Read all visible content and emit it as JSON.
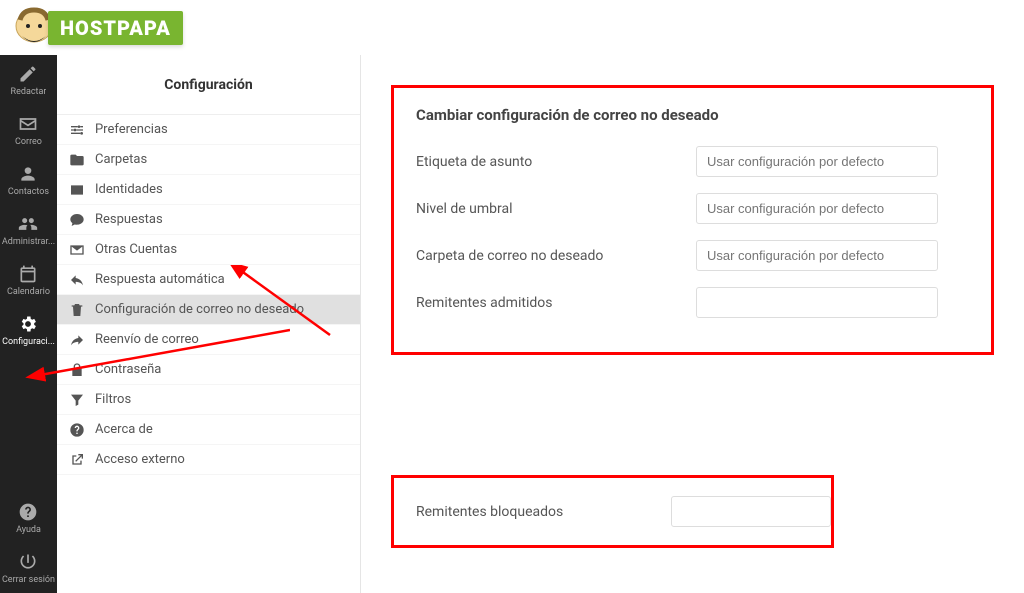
{
  "brand": "HOSTPAPA",
  "sidebar": {
    "items": [
      {
        "icon": "edit",
        "label": "Redactar"
      },
      {
        "icon": "mail",
        "label": "Correo"
      },
      {
        "icon": "contacts",
        "label": "Contactos"
      },
      {
        "icon": "users",
        "label": "Administrar..."
      },
      {
        "icon": "calendar",
        "label": "Calendario"
      },
      {
        "icon": "gear",
        "label": "Configuraci..."
      }
    ],
    "bottom": [
      {
        "icon": "help",
        "label": "Ayuda"
      },
      {
        "icon": "power",
        "label": "Cerrar sesión"
      }
    ]
  },
  "settings": {
    "header": "Configuración",
    "items": [
      {
        "icon": "sliders",
        "label": "Preferencias"
      },
      {
        "icon": "folder",
        "label": "Carpetas"
      },
      {
        "icon": "idcard",
        "label": "Identidades"
      },
      {
        "icon": "comment",
        "label": "Respuestas"
      },
      {
        "icon": "envelope",
        "label": "Otras Cuentas"
      },
      {
        "icon": "reply",
        "label": "Respuesta automática"
      },
      {
        "icon": "trash",
        "label": "Configuración de correo no deseado"
      },
      {
        "icon": "forward",
        "label": "Reenvío de correo"
      },
      {
        "icon": "lock",
        "label": "Contraseña"
      },
      {
        "icon": "filter",
        "label": "Filtros"
      },
      {
        "icon": "help",
        "label": "Acerca de"
      },
      {
        "icon": "external",
        "label": "Acceso externo"
      }
    ]
  },
  "content": {
    "title": "Cambiar configuración de correo no deseado",
    "rows": [
      {
        "label": "Etiqueta de asunto",
        "placeholder": "Usar configuración por defecto"
      },
      {
        "label": "Nivel de umbral",
        "placeholder": "Usar configuración por defecto"
      },
      {
        "label": "Carpeta de correo no deseado",
        "placeholder": "Usar configuración por defecto"
      },
      {
        "label": "Remitentes admitidos",
        "placeholder": ""
      }
    ],
    "blocked": {
      "label": "Remitentes bloqueados",
      "placeholder": ""
    }
  }
}
